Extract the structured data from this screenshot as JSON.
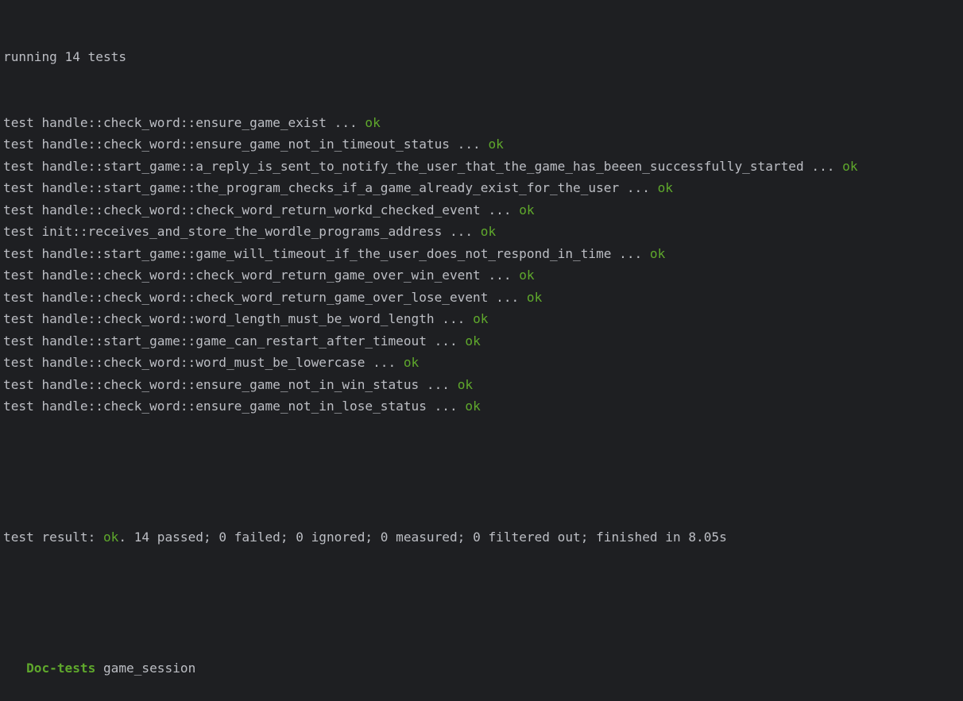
{
  "terminal": {
    "running_line": "running 14 tests",
    "test_prefix": "test ",
    "dots": " ... ",
    "ok_text": "ok",
    "tests": [
      "handle::check_word::ensure_game_exist",
      "handle::check_word::ensure_game_not_in_timeout_status",
      "handle::start_game::a_reply_is_sent_to_notify_the_user_that_the_game_has_beeen_successfully_started",
      "handle::start_game::the_program_checks_if_a_game_already_exist_for_the_user",
      "handle::check_word::check_word_return_workd_checked_event",
      "init::receives_and_store_the_wordle_programs_address",
      "handle::start_game::game_will_timeout_if_the_user_does_not_respond_in_time",
      "handle::check_word::check_word_return_game_over_win_event",
      "handle::check_word::check_word_return_game_over_lose_event",
      "handle::check_word::word_length_must_be_word_length",
      "handle::start_game::game_can_restart_after_timeout",
      "handle::check_word::word_must_be_lowercase",
      "handle::check_word::ensure_game_not_in_win_status",
      "handle::check_word::ensure_game_not_in_lose_status"
    ],
    "result_prefix": "test result: ",
    "result_ok": "ok",
    "result_rest": ". 14 passed; 0 failed; 0 ignored; 0 measured; 0 filtered out; finished in 8.05s",
    "doc_tests_indent": "   ",
    "doc_tests_label": "Doc-tests",
    "doc_tests_name": " game_session"
  },
  "colors": {
    "background": "#1e1f22",
    "text": "#bcbec4",
    "ok": "#5fa82c"
  }
}
